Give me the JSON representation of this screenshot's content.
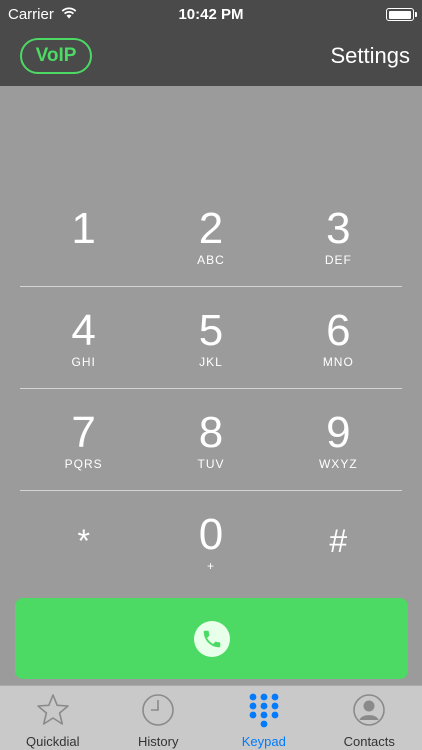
{
  "status_bar": {
    "carrier": "Carrier",
    "time": "10:42 PM"
  },
  "nav": {
    "voip_label": "VoIP",
    "settings_label": "Settings"
  },
  "keypad": {
    "rows": [
      [
        {
          "digit": "1",
          "letters": ""
        },
        {
          "digit": "2",
          "letters": "ABC"
        },
        {
          "digit": "3",
          "letters": "DEF"
        }
      ],
      [
        {
          "digit": "4",
          "letters": "GHI"
        },
        {
          "digit": "5",
          "letters": "JKL"
        },
        {
          "digit": "6",
          "letters": "MNO"
        }
      ],
      [
        {
          "digit": "7",
          "letters": "PQRS"
        },
        {
          "digit": "8",
          "letters": "TUV"
        },
        {
          "digit": "9",
          "letters": "WXYZ"
        }
      ],
      [
        {
          "digit": "*",
          "letters": ""
        },
        {
          "digit": "0",
          "letters": "+"
        },
        {
          "digit": "#",
          "letters": ""
        }
      ]
    ]
  },
  "call_button": {
    "icon": "phone-icon",
    "color": "#4cd964"
  },
  "tabs": [
    {
      "label": "Quickdial",
      "icon": "star-icon",
      "active": false
    },
    {
      "label": "History",
      "icon": "clock-icon",
      "active": false
    },
    {
      "label": "Keypad",
      "icon": "keypad-icon",
      "active": true
    },
    {
      "label": "Contacts",
      "icon": "contacts-icon",
      "active": false
    }
  ],
  "colors": {
    "accent": "#007aff",
    "green": "#4cd964",
    "nav_bg": "#4a4a4a",
    "content_bg": "#9b9b9b"
  }
}
